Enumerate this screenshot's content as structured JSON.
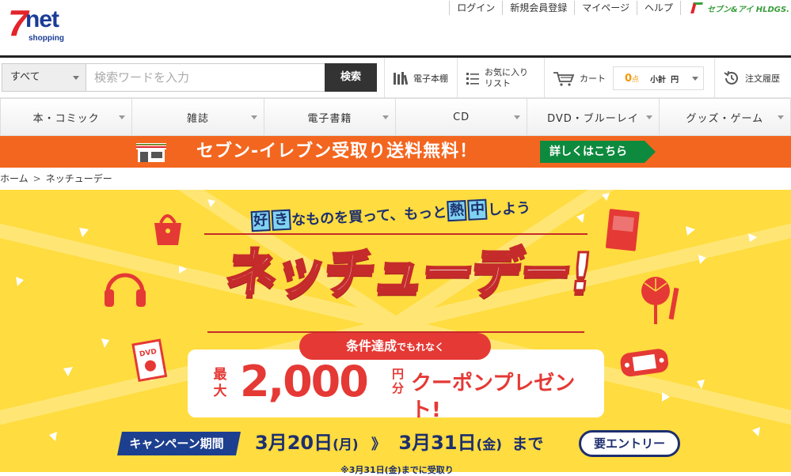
{
  "header": {
    "logo": {
      "seven": "7",
      "net": "net",
      "shopping": "shopping"
    },
    "links": [
      "ログイン",
      "新規会員登録",
      "マイページ",
      "ヘルプ"
    ],
    "holdings": "セブン&アイ HLDGS."
  },
  "search": {
    "scope": "すべて",
    "placeholder": "検索ワードを入力",
    "button": "検索"
  },
  "tools": {
    "ebook": "電子本棚",
    "favorites_line1": "お気に入り",
    "favorites_line2": "リスト",
    "cart": "カート",
    "points_value": "0",
    "points_unit": "点",
    "subtotal_label": "小計",
    "subtotal_unit": "円",
    "history": "注文履歴"
  },
  "categories": [
    "本・コミック",
    "雑誌",
    "電子書籍",
    "CD",
    "DVD・ブルーレイ",
    "グッズ・ゲーム"
  ],
  "promo": {
    "text": "セブン-イレブン受取り送料無料！",
    "more": "詳しくはこちら"
  },
  "breadcrumb": [
    "ホーム",
    "ネッチューデー"
  ],
  "hero": {
    "tag_pre": "",
    "tag_box1": "好",
    "tag_box2": "き",
    "tag_mid": "なものを買って、もっと",
    "tag_box3": "熱",
    "tag_box4": "中",
    "tag_post": "しよう",
    "title": "ネッチューデー!",
    "condition_main": "条件達成",
    "condition_small": "でもれなく",
    "max_label_1": "最",
    "max_label_2": "大",
    "amount": "2,000",
    "yen_1": "円",
    "yen_2": "分",
    "coupon": "クーポンプレゼント!",
    "period_label": "キャンペーン期間",
    "date_from": "3月20日",
    "dow_from": "(月)",
    "arrow": "》",
    "date_to": "3月31日",
    "dow_to": "(金)",
    "until": "まで",
    "entry": "要エントリー",
    "note": "※3月31日(金)までに受取り"
  },
  "colors": {
    "promo_orange": "#f3661f",
    "hero_yellow": "#ffdc3f",
    "accent_red": "#e53935",
    "navy": "#1d2f6e",
    "promo_green": "#0e8a3f"
  }
}
